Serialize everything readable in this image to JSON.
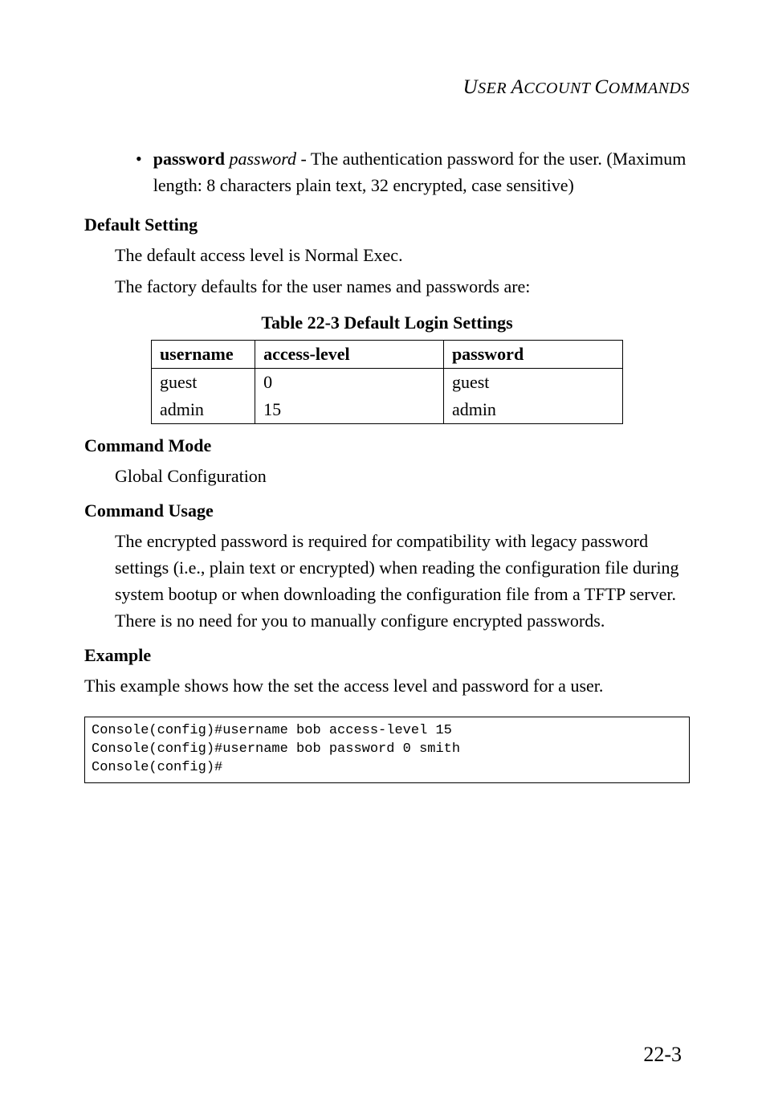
{
  "header": "USER ACCOUNT COMMANDS",
  "bullet": {
    "lead_bold": "password",
    "lead_italic": "password",
    "rest": " - The authentication password for the user. (Maximum length: 8 characters plain text, 32 encrypted, case sensitive)"
  },
  "sections": {
    "default_setting": {
      "heading": "Default Setting",
      "line1": "The default access level is Normal Exec.",
      "line2": "The factory defaults for the user names and passwords are:"
    },
    "table": {
      "caption": "Table 22-3  Default Login Settings",
      "headers": [
        "username",
        "access-level",
        "password"
      ],
      "rows": [
        [
          "guest",
          "0",
          "guest"
        ],
        [
          "admin",
          "15",
          "admin"
        ]
      ]
    },
    "command_mode": {
      "heading": "Command Mode",
      "body": "Global Configuration"
    },
    "command_usage": {
      "heading": "Command Usage",
      "body": "The encrypted password is required for compatibility with legacy password settings (i.e., plain text or encrypted) when reading the configuration file during system bootup or when downloading the configuration file from a TFTP server. There is no need for you to manually configure encrypted passwords."
    },
    "example": {
      "heading": "Example",
      "intro": "This example shows how the set the access level and password for a user.",
      "console": "Console(config)#username bob access-level 15\nConsole(config)#username bob password 0 smith\nConsole(config)#"
    }
  },
  "page_number": "22-3"
}
